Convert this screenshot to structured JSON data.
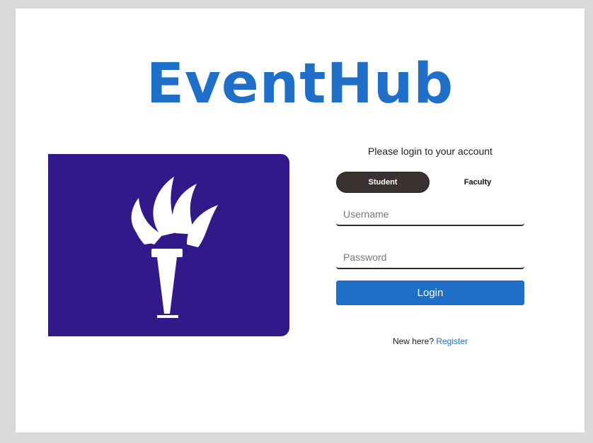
{
  "app": {
    "brand": "EventHub"
  },
  "login": {
    "prompt": "Please login to your account",
    "roles": [
      {
        "label": "Student",
        "selected": true
      },
      {
        "label": "Faculty",
        "selected": false
      }
    ],
    "username_placeholder": "Username",
    "username_value": "",
    "password_placeholder": "Password",
    "password_value": "",
    "login_label": "Login",
    "register_prefix": "New here?",
    "register_link": "Register"
  },
  "colors": {
    "brand_blue": "#1f6fc8",
    "logo_panel": "#31198a",
    "selected_role": "#3a3131",
    "frame_border": "#d9d9d9"
  },
  "icons": {
    "logo": "torch-icon"
  }
}
